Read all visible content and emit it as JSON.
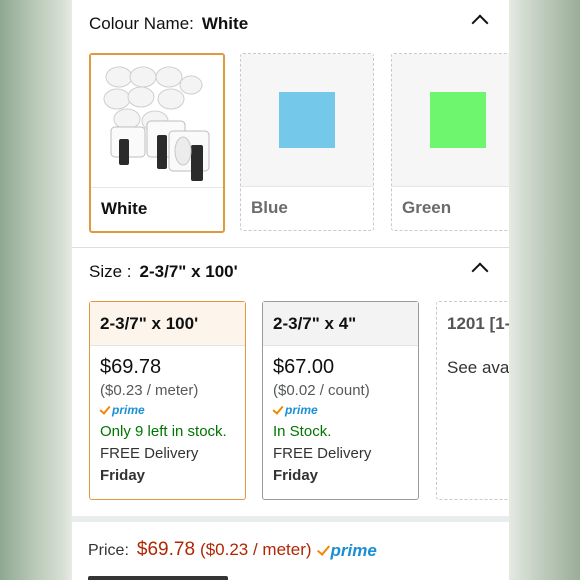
{
  "colour": {
    "label": "Colour Name:",
    "selected": "White"
  },
  "colour_options": [
    {
      "name": "White",
      "state": "selected"
    },
    {
      "name": "Blue",
      "state": "unavailable",
      "swatch_color": "#74c9ea"
    },
    {
      "name": "Green",
      "state": "unavailable",
      "swatch_color": "#6ef76e"
    }
  ],
  "size": {
    "label": "Size :",
    "selected": "2-3/7\" x 100'"
  },
  "size_options": [
    {
      "title": "2-3/7\" x 100'",
      "price": "$69.78",
      "unit_price": "($0.23 / meter)",
      "prime": "prime",
      "stock": "Only 9 left in stock.",
      "delivery": "FREE Delivery",
      "day": "Friday"
    },
    {
      "title": "2-3/7\" x 4\"",
      "price": "$67.00",
      "unit_price": "($0.02 / count)",
      "prime": "prime",
      "stock": "In Stock.",
      "delivery": "FREE Delivery",
      "day": "Friday"
    },
    {
      "title": "1201 [1-",
      "see_available": "See avai"
    }
  ],
  "price_line": {
    "label": "Price:",
    "value": "$69.78",
    "unit": "($0.23 / meter)",
    "prime": "prime"
  },
  "colors": {
    "accent_selected": "#e09a3e",
    "price_red": "#b12704",
    "stock_green": "#007600",
    "prime_blue": "#1a8fd6",
    "prime_orange": "#f08804"
  }
}
